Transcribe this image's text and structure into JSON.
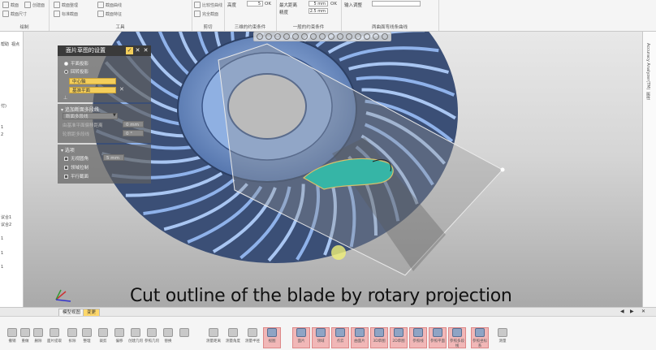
{
  "ribbon": {
    "group_labels": [
      "绘制",
      "工具",
      "剪切",
      "三维的约束条件",
      "一般的约束条件",
      "两曲面弯线条曲线"
    ],
    "top_buttons": [
      "截面",
      "创建面",
      "截面整理",
      "剪切截面",
      "比较性曲线",
      "区域草图"
    ],
    "sub_buttons": [
      "截面尺寸",
      "标准截面",
      "截面曲线",
      "截面特征",
      "完全截面"
    ],
    "fields": {
      "height_label": "高度",
      "height_value": "5",
      "max_distance_label": "最大距离",
      "max_distance_value": "5 mm",
      "precision_label": "精度",
      "precision_value": "2.5 mm",
      "input_label": "输入调整",
      "ok": "OK"
    }
  },
  "left_panel": {
    "tabs": [
      "帮助",
      "视点"
    ],
    "items": [
      "付)",
      "1",
      "2",
      "议合1",
      "议合2",
      "1",
      "1",
      "1"
    ]
  },
  "right_panel": {
    "texts": [
      "Accuracy Analyzer(TM)",
      "属性"
    ]
  },
  "dialog": {
    "title": "面片草图的设置",
    "sections": {
      "projection": {
        "option_plane": "平面投影",
        "option_rotary": "回转投影",
        "field_axis": "中心轴",
        "field_base_plane": "基准平面"
      },
      "polyline": {
        "title": "追加断面多段线",
        "field_mode": "断面多段线",
        "offset_label": "由基准平面偏移距离",
        "offset_value": "0 mm",
        "angle_label": "轮廓距多段线",
        "angle_value": "0 °"
      },
      "options": {
        "title": "选项",
        "opt_infinite": "无视圆角",
        "opt_infinite_value": "5 mm",
        "opt_region": "领域拉制",
        "opt_parallel": "平行截面"
      }
    }
  },
  "caption": "Cut outline of the blade by rotary projection",
  "tabs": [
    "模型视图",
    "变更"
  ],
  "bottom_toolbar": {
    "buttons": [
      "撤销",
      "重做",
      "删除",
      "面片提取",
      "拆除",
      "整理",
      "裁剪",
      "偏移",
      "创建几何",
      "参照几何",
      "替换",
      "",
      "测量距离",
      "测量角度",
      "测量半径",
      "视图",
      "面片",
      "领域",
      "点云",
      "曲面片",
      "3D草图",
      "2D草图",
      "参照线",
      "参照平面",
      "参照多段线",
      "参照坐标系",
      "测量"
    ]
  },
  "colors": {
    "dialog_header": "#3a3a3a",
    "selected_field": "#f4ce5a",
    "highlight_button": "#f1b7b7",
    "impeller": "#7fa0d6"
  }
}
